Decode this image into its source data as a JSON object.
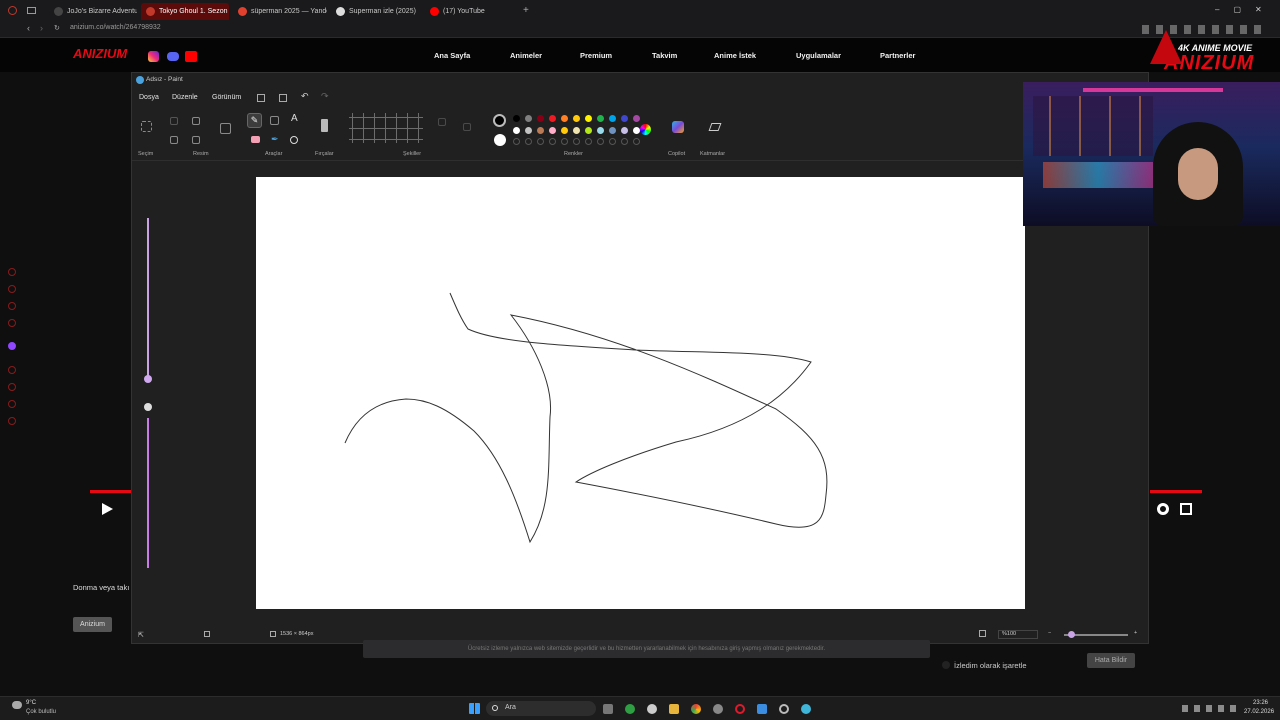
{
  "browser": {
    "tabs": [
      {
        "label": "JoJo's Bizarre Adventure",
        "active": false,
        "icon_color": "#444"
      },
      {
        "label": "Tokyo Ghoul 1. Sezon 7. B",
        "active": true,
        "icon_color": "#c0392b"
      },
      {
        "label": "süperman 2025 — Yande",
        "active": false,
        "icon_color": "#e0412e"
      },
      {
        "label": "Superman izle (2025)",
        "active": false,
        "icon_color": "#ddd"
      },
      {
        "label": "(17) YouTube",
        "active": false,
        "icon_color": "#ff0000"
      }
    ],
    "new_tab": "+",
    "url": "anizium.co/watch/264798932"
  },
  "site": {
    "nav": [
      "Ana Sayfa",
      "Animeler",
      "Premium",
      "Takvim",
      "Anime İstek",
      "Uygulamalar",
      "Partnerler"
    ],
    "brand_text": "4K ANIME MOVIE",
    "brand_name": "ANIZIUM"
  },
  "paint": {
    "title": "Adsız - Paint",
    "menus": [
      "Dosya",
      "Düzenle",
      "Görünüm"
    ],
    "groups": [
      "Seçim",
      "Resim",
      "Araçlar",
      "Fırçalar",
      "Şekiller",
      "Renkler",
      "Copilot",
      "Katmanlar"
    ],
    "colors_row1": [
      "#000000",
      "#7f7f7f",
      "#880015",
      "#ed1c24",
      "#ff7f27",
      "#ffc90e",
      "#fff200",
      "#22b14c",
      "#00a2e8",
      "#3f48cc",
      "#a349a4"
    ],
    "colors_row2": [
      "#ffffff",
      "#c3c3c3",
      "#b97a57",
      "#ffaec9",
      "#ffc90e",
      "#efe4b0",
      "#b5e61d",
      "#99d9ea",
      "#7092be",
      "#c8bfe7",
      "#ffffff"
    ],
    "canvas_size": "1536 × 864px",
    "zoom": "%100"
  },
  "page_below": {
    "episode_text": "Donma veya takı",
    "badge": "Anizium",
    "notice": "Ücretsiz izleme yalnızca web sitemizde geçerlidir ve bu hizmetten yararlanabilmek için hesabınıza giriş yapmış olmanız gerekmektedir.",
    "watched": "İzledim olarak işaretle",
    "report": "Hata Bildir"
  },
  "taskbar": {
    "weather_temp": "9°C",
    "weather_desc": "Çok bulutlu",
    "search": "Ara",
    "time": "23:26",
    "date": "27.02.2026"
  },
  "accent": "#e50914"
}
